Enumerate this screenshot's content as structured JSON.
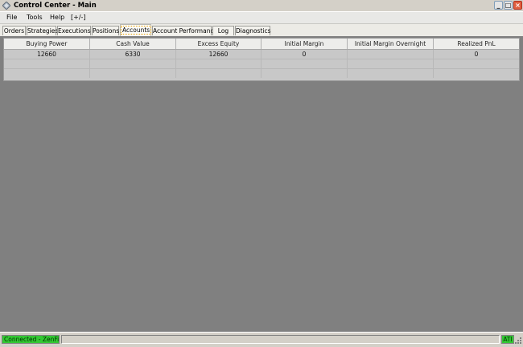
{
  "window": {
    "title": "Control Center - Main"
  },
  "menu": [
    {
      "label": "File"
    },
    {
      "label": "Tools"
    },
    {
      "label": "Help"
    },
    {
      "label": "[+/-]"
    }
  ],
  "tabs": [
    {
      "label": "Orders",
      "active": false
    },
    {
      "label": "Strategies",
      "active": false
    },
    {
      "label": "Executions",
      "active": false
    },
    {
      "label": "Positions",
      "active": false
    },
    {
      "label": "Accounts",
      "active": true
    },
    {
      "label": "Account Performance",
      "active": false
    },
    {
      "label": "Log",
      "active": false
    },
    {
      "label": "Diagnostics",
      "active": false
    }
  ],
  "grid": {
    "columns": [
      "Buying Power",
      "Cash Value",
      "Excess Equity",
      "Initial Margin",
      "Initial Margin Overnight",
      "Realized PnL"
    ],
    "rows": [
      [
        "12660",
        "6330",
        "12660",
        "0",
        "",
        "0"
      ],
      [
        "",
        "",
        "",
        "",
        "",
        ""
      ],
      [
        "",
        "",
        "",
        "",
        "",
        ""
      ]
    ]
  },
  "status": {
    "connection": "Connected - ZenFire",
    "ati": "ATI"
  },
  "colors": {
    "status_ok": "#33c833",
    "background": "#808080"
  },
  "icons": {
    "app": "diamond-arrows-icon",
    "minimize": "minimize-icon",
    "maximize": "maximize-icon",
    "close": "close-icon",
    "grip": "resize-grip-icon"
  }
}
